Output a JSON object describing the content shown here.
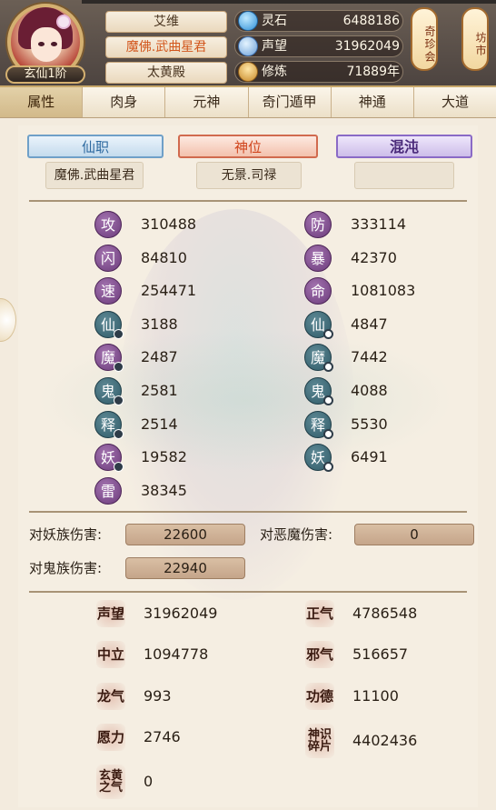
{
  "header": {
    "rank": "玄仙1阶",
    "name": "艾维",
    "title": "魔佛.武曲星君",
    "palace": "太黄殿",
    "resources": [
      {
        "icon": "spirit-stone-icon",
        "label": "灵石",
        "value": "6488186"
      },
      {
        "icon": "reputation-gem-icon",
        "label": "声望",
        "value": "31962049"
      },
      {
        "icon": "meditation-icon",
        "label": "修炼",
        "value": "71889年"
      }
    ],
    "side_buttons": [
      "奇珍会",
      "坊市"
    ]
  },
  "tabs": [
    "属性",
    "肉身",
    "元神",
    "奇门遁甲",
    "神通",
    "大道"
  ],
  "active_tab": 0,
  "positions": {
    "official": {
      "label": "仙职",
      "value": "魔佛.武曲星君"
    },
    "divine": {
      "label": "神位",
      "value": "无景.司禄"
    },
    "chaos": {
      "label": "混沌",
      "value": ""
    }
  },
  "stats_left": [
    {
      "icon": "攻",
      "value": "310488",
      "color": "purple",
      "marker": ""
    },
    {
      "icon": "闪",
      "value": "84810",
      "color": "purple",
      "marker": ""
    },
    {
      "icon": "速",
      "value": "254471",
      "color": "purple",
      "marker": ""
    },
    {
      "icon": "仙",
      "value": "3188",
      "color": "teal",
      "marker": "dot"
    },
    {
      "icon": "魔",
      "value": "2487",
      "color": "purple",
      "marker": "dot"
    },
    {
      "icon": "鬼",
      "value": "2581",
      "color": "teal",
      "marker": "dot"
    },
    {
      "icon": "释",
      "value": "2514",
      "color": "teal",
      "marker": "dot"
    },
    {
      "icon": "妖",
      "value": "19582",
      "color": "purple",
      "marker": "dot"
    },
    {
      "icon": "雷",
      "value": "38345",
      "color": "purple",
      "marker": ""
    }
  ],
  "stats_right": [
    {
      "icon": "防",
      "value": "333114",
      "color": "purple",
      "marker": ""
    },
    {
      "icon": "暴",
      "value": "42370",
      "color": "purple",
      "marker": ""
    },
    {
      "icon": "命",
      "value": "1081083",
      "color": "purple",
      "marker": ""
    },
    {
      "icon": "仙",
      "value": "4847",
      "color": "teal",
      "marker": "ring"
    },
    {
      "icon": "魔",
      "value": "7442",
      "color": "teal",
      "marker": "ring"
    },
    {
      "icon": "鬼",
      "value": "4088",
      "color": "teal",
      "marker": "ring"
    },
    {
      "icon": "释",
      "value": "5530",
      "color": "teal",
      "marker": "ring"
    },
    {
      "icon": "妖",
      "value": "6491",
      "color": "teal",
      "marker": "ring"
    }
  ],
  "damage": [
    {
      "label": "对妖族伤害:",
      "value": "22600"
    },
    {
      "label": "对恶魔伤害:",
      "value": "0"
    },
    {
      "label": "对鬼族伤害:",
      "value": "22940"
    }
  ],
  "attrs_left": [
    {
      "seal": "声望",
      "value": "31962049"
    },
    {
      "seal": "中立",
      "value": "1094778"
    },
    {
      "seal": "龙气",
      "value": "993"
    },
    {
      "seal": "愿力",
      "value": "2746"
    },
    {
      "seal": "玄黄之气",
      "value": "0"
    }
  ],
  "attrs_right": [
    {
      "seal": "正气",
      "value": "4786548"
    },
    {
      "seal": "邪气",
      "value": "516657"
    },
    {
      "seal": "功德",
      "value": "11100"
    },
    {
      "seal": "神识碎片",
      "value": "4402436"
    }
  ],
  "colors": {
    "accent_gold": "#c8a86a",
    "title_orange": "#d2561c",
    "panel_bg": "#f5eee2"
  }
}
